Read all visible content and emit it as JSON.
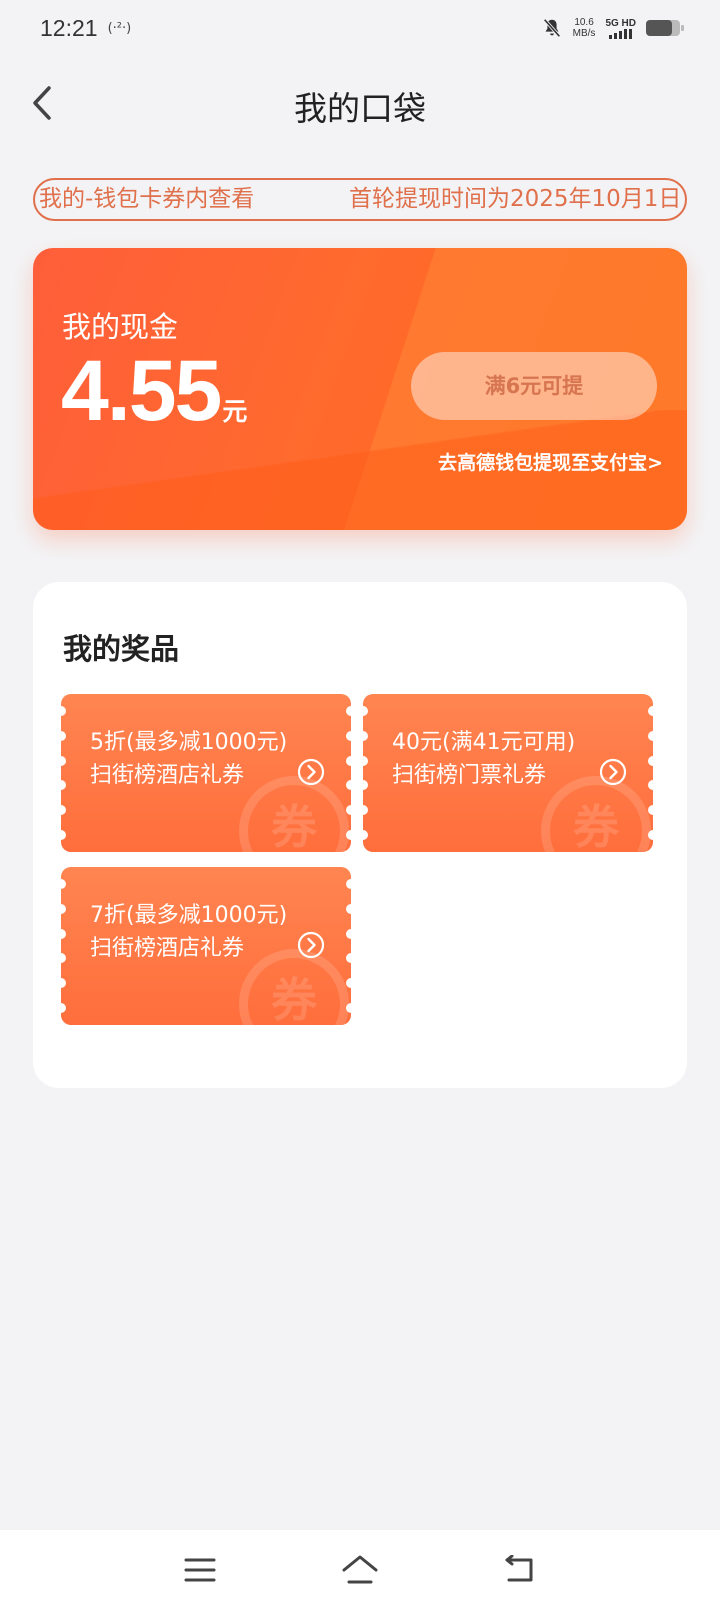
{
  "status_bar": {
    "time": "12:21",
    "signal_hint": "(·²·)",
    "net_speed_value": "10.6",
    "net_speed_unit": "MB/s",
    "network_type": "5G HD",
    "battery_level": 0.75
  },
  "header": {
    "title": "我的口袋"
  },
  "notice": {
    "text_1": "我的-钱包卡券内查看",
    "text_2": "首轮提现时间为2025年10月1日"
  },
  "cash": {
    "label": "我的现金",
    "amount": "4.55",
    "unit": "元",
    "withdraw_label": "满6元可提",
    "wallet_link": "去高德钱包提现至支付宝>"
  },
  "prizes": {
    "title": "我的奖品",
    "watermark": "券",
    "coupons": [
      {
        "line1": "5折(最多减1000元)",
        "line2": "扫街榜酒店礼券"
      },
      {
        "line1": "40元(满41元可用)",
        "line2": "扫街榜门票礼券"
      },
      {
        "line1": "7折(最多减1000元)",
        "line2": "扫街榜酒店礼券"
      }
    ]
  },
  "colors": {
    "accent": "#ff6a2d",
    "notice": "#e0704b",
    "background": "#f3f3f5"
  }
}
